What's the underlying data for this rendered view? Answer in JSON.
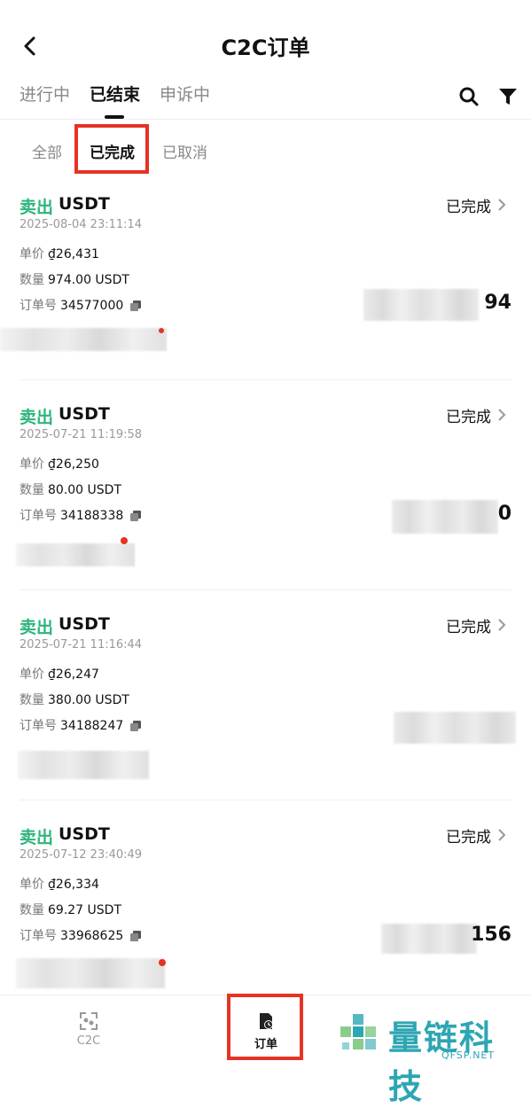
{
  "header": {
    "title": "C2C订单"
  },
  "tabs": [
    {
      "label": "进行中"
    },
    {
      "label": "已结束"
    },
    {
      "label": "申诉中"
    }
  ],
  "subtabs": [
    {
      "label": "全部"
    },
    {
      "label": "已完成"
    },
    {
      "label": "已取消"
    }
  ],
  "labels": {
    "price": "单价",
    "quantity": "数量",
    "order_no": "订单号"
  },
  "orders": [
    {
      "side": "卖出",
      "asset": "USDT",
      "status": "已完成",
      "time": "2025-08-04 23:11:14",
      "price": "₫26,431",
      "quantity": "974.00 USDT",
      "order_no": "34577000",
      "amount_fragment": "94"
    },
    {
      "side": "卖出",
      "asset": "USDT",
      "status": "已完成",
      "time": "2025-07-21 11:19:58",
      "price": "₫26,250",
      "quantity": "80.00 USDT",
      "order_no": "34188338",
      "amount_fragment": "0"
    },
    {
      "side": "卖出",
      "asset": "USDT",
      "status": "已完成",
      "time": "2025-07-21 11:16:44",
      "price": "₫26,247",
      "quantity": "380.00 USDT",
      "order_no": "34188247",
      "amount_fragment": ""
    },
    {
      "side": "卖出",
      "asset": "USDT",
      "status": "已完成",
      "time": "2025-07-12 23:40:49",
      "price": "₫26,334",
      "quantity": "69.27 USDT",
      "order_no": "33968625",
      "amount_fragment": "156"
    }
  ],
  "bottom_nav": [
    {
      "label": "C2C",
      "icon": "c2c-icon"
    },
    {
      "label": "订单",
      "icon": "orders-icon"
    }
  ],
  "watermark": {
    "text": "量链科技",
    "sub": "QFSP.NET"
  },
  "colors": {
    "accent_green": "#2db57c",
    "highlight_red": "#e53324",
    "watermark": "#2da6b3"
  }
}
